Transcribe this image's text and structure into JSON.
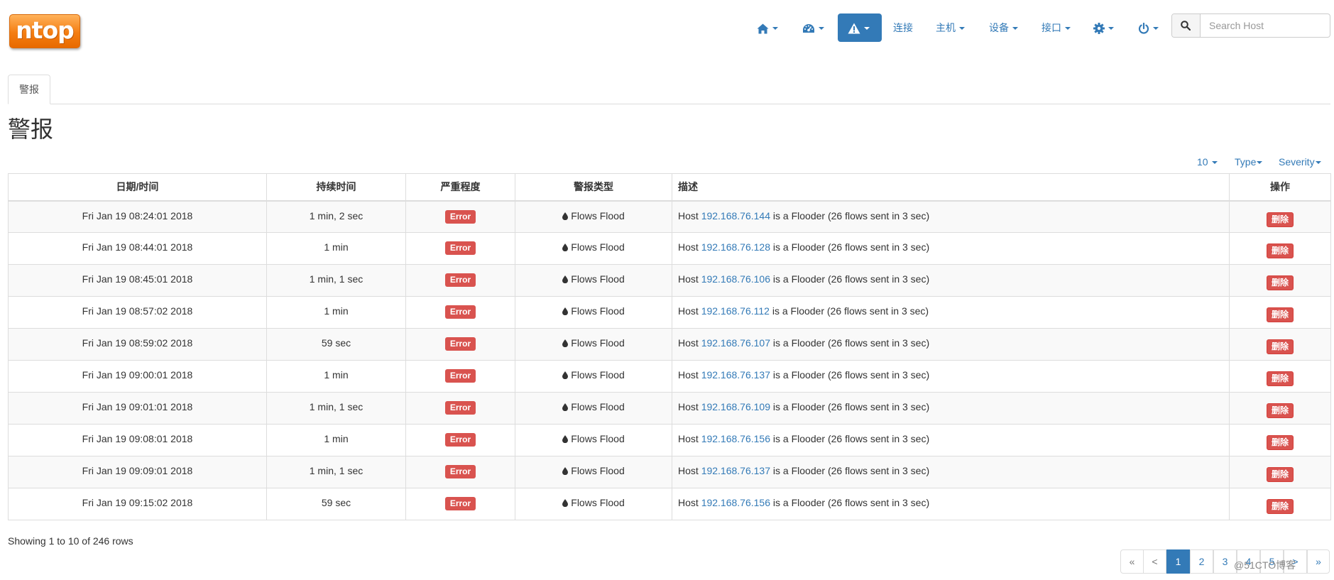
{
  "brand": {
    "logo_text": "ntop"
  },
  "nav": {
    "home_icon": "home-icon",
    "dashboard_icon": "dashboard-gauge-icon",
    "alerts_icon": "warning-triangle-icon",
    "flows_label": "连接",
    "hosts_label": "主机",
    "devices_label": "设备",
    "interfaces_label": "接口",
    "settings_icon": "gear-icon",
    "power_icon": "power-icon"
  },
  "search": {
    "placeholder": "Search Host",
    "icon": "search-icon"
  },
  "tab": {
    "label": "警报"
  },
  "page": {
    "title": "警报"
  },
  "toolbar": {
    "per_page": "10",
    "type_filter": "Type",
    "severity_filter": "Severity"
  },
  "table": {
    "columns": {
      "datetime": "日期/时间",
      "duration": "持续时间",
      "severity": "严重程度",
      "alert_type": "警报类型",
      "description": "描述",
      "actions": "操作"
    },
    "rows": [
      {
        "datetime": "Fri Jan 19 08:24:01 2018",
        "duration": "1 min, 2 sec",
        "severity": "Error",
        "type": "Flows Flood",
        "desc_prefix": "Host",
        "host": "192.168.76.144",
        "desc_suffix": "is a Flooder (26 flows sent in 3 sec)",
        "action": "删除"
      },
      {
        "datetime": "Fri Jan 19 08:44:01 2018",
        "duration": "1 min",
        "severity": "Error",
        "type": "Flows Flood",
        "desc_prefix": "Host",
        "host": "192.168.76.128",
        "desc_suffix": "is a Flooder (26 flows sent in 3 sec)",
        "action": "删除"
      },
      {
        "datetime": "Fri Jan 19 08:45:01 2018",
        "duration": "1 min, 1 sec",
        "severity": "Error",
        "type": "Flows Flood",
        "desc_prefix": "Host",
        "host": "192.168.76.106",
        "desc_suffix": "is a Flooder (26 flows sent in 3 sec)",
        "action": "删除"
      },
      {
        "datetime": "Fri Jan 19 08:57:02 2018",
        "duration": "1 min",
        "severity": "Error",
        "type": "Flows Flood",
        "desc_prefix": "Host",
        "host": "192.168.76.112",
        "desc_suffix": "is a Flooder (26 flows sent in 3 sec)",
        "action": "删除"
      },
      {
        "datetime": "Fri Jan 19 08:59:02 2018",
        "duration": "59 sec",
        "severity": "Error",
        "type": "Flows Flood",
        "desc_prefix": "Host",
        "host": "192.168.76.107",
        "desc_suffix": "is a Flooder (26 flows sent in 3 sec)",
        "action": "删除"
      },
      {
        "datetime": "Fri Jan 19 09:00:01 2018",
        "duration": "1 min",
        "severity": "Error",
        "type": "Flows Flood",
        "desc_prefix": "Host",
        "host": "192.168.76.137",
        "desc_suffix": "is a Flooder (26 flows sent in 3 sec)",
        "action": "删除"
      },
      {
        "datetime": "Fri Jan 19 09:01:01 2018",
        "duration": "1 min, 1 sec",
        "severity": "Error",
        "type": "Flows Flood",
        "desc_prefix": "Host",
        "host": "192.168.76.109",
        "desc_suffix": "is a Flooder (26 flows sent in 3 sec)",
        "action": "删除"
      },
      {
        "datetime": "Fri Jan 19 09:08:01 2018",
        "duration": "1 min",
        "severity": "Error",
        "type": "Flows Flood",
        "desc_prefix": "Host",
        "host": "192.168.76.156",
        "desc_suffix": "is a Flooder (26 flows sent in 3 sec)",
        "action": "删除"
      },
      {
        "datetime": "Fri Jan 19 09:09:01 2018",
        "duration": "1 min, 1 sec",
        "severity": "Error",
        "type": "Flows Flood",
        "desc_prefix": "Host",
        "host": "192.168.76.137",
        "desc_suffix": "is a Flooder (26 flows sent in 3 sec)",
        "action": "删除"
      },
      {
        "datetime": "Fri Jan 19 09:15:02 2018",
        "duration": "59 sec",
        "severity": "Error",
        "type": "Flows Flood",
        "desc_prefix": "Host",
        "host": "192.168.76.156",
        "desc_suffix": "is a Flooder (26 flows sent in 3 sec)",
        "action": "删除"
      }
    ]
  },
  "footer": {
    "showing": "Showing 1 to 10 of 246 rows"
  },
  "pagination": {
    "first": "«",
    "prev": "<",
    "pages": [
      "1",
      "2",
      "3",
      "4",
      "5"
    ],
    "next": ">",
    "last": "»",
    "current": "1"
  },
  "watermark": "@51CTO博客",
  "colors": {
    "accent": "#337ab7",
    "danger": "#d9534f",
    "logo": "#f47d12"
  }
}
